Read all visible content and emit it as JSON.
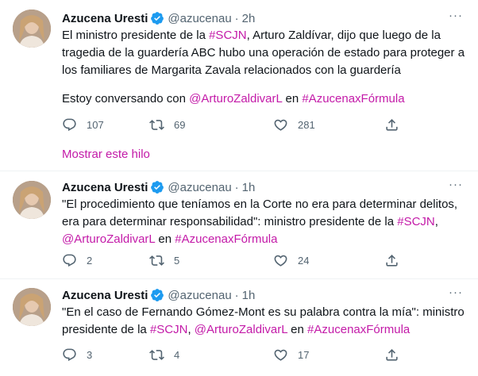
{
  "tweets": [
    {
      "name": "Azucena Uresti",
      "handle": "@azucenau",
      "dot": "·",
      "time": "2h",
      "more": "···",
      "text_a": "El ministro presidente de la ",
      "link_a": "#SCJN",
      "text_b": ", Arturo Zaldívar,  dijo que luego de la tragedia de la guardería ABC hubo una operación de estado para proteger a los familiares de Margarita Zavala relacionados con la guardería",
      "text_c": "Estoy conversando con  ",
      "link_b": "@ArturoZaldivarL",
      "text_d": " en ",
      "link_c": "#AzucenaxFórmula",
      "replies": "107",
      "retweets": "69",
      "likes": "281"
    },
    {
      "name": "Azucena Uresti",
      "handle": "@azucenau",
      "dot": "·",
      "time": "1h",
      "more": "···",
      "text_a": "\"El procedimiento que teníamos en la Corte no era para determinar delitos, era para determinar responsabilidad\": ministro presidente de la ",
      "link_a": "#SCJN",
      "text_b": ", ",
      "link_b": "@ArturoZaldivarL",
      "text_d": " en ",
      "link_c": "#AzucenaxFórmula",
      "replies": "2",
      "retweets": "5",
      "likes": "24"
    },
    {
      "name": "Azucena Uresti",
      "handle": "@azucenau",
      "dot": "·",
      "time": "1h",
      "more": "···",
      "text_a": "\"En el caso de Fernando Gómez-Mont es su palabra contra la mía\": ministro presidente de la ",
      "link_a": "#SCJN",
      "text_b": ", ",
      "link_b": "@ArturoZaldivarL",
      "text_d": " en ",
      "link_c": "#AzucenaxFórmula",
      "replies": "3",
      "retweets": "4",
      "likes": "17"
    }
  ],
  "show_thread": "Mostrar este hilo",
  "colors": {
    "link": "#c31aa8",
    "muted": "#536471",
    "verified": "#1d9bf0",
    "divider": "#eff3f4"
  },
  "icons": [
    "verified-badge-icon",
    "reply-icon",
    "retweet-icon",
    "like-icon",
    "share-icon",
    "more-icon"
  ]
}
